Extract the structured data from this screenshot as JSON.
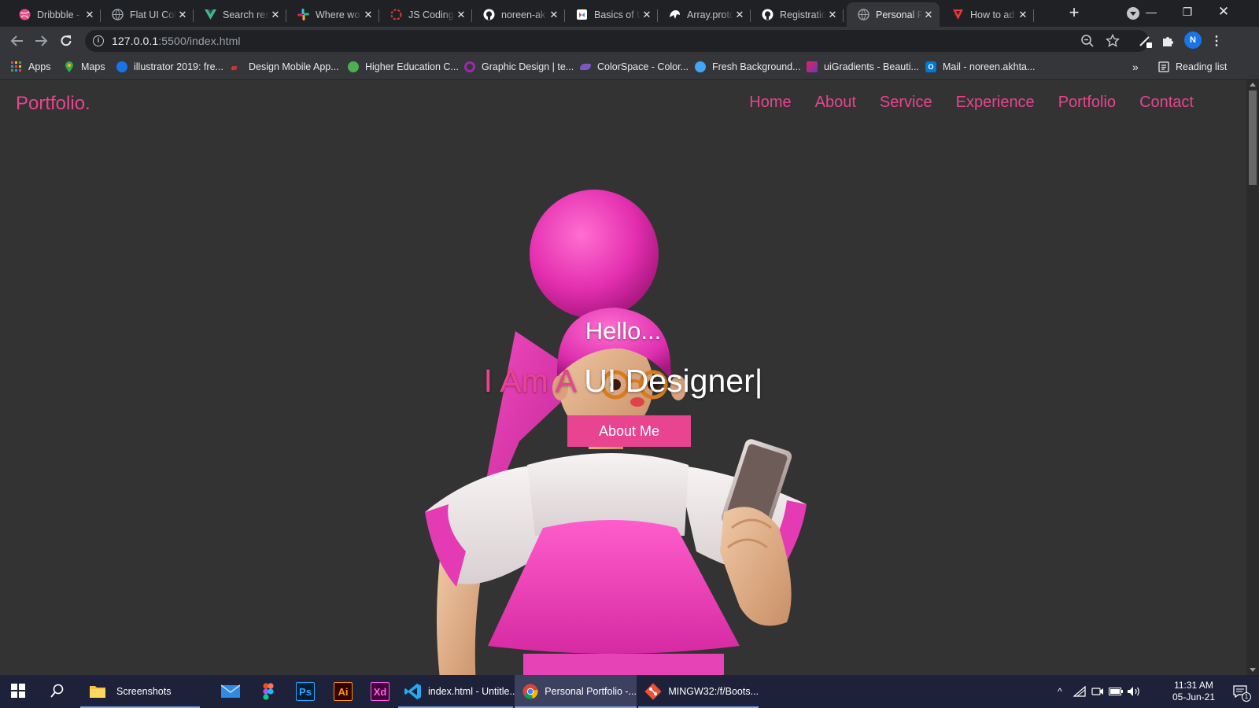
{
  "browser": {
    "tabs": [
      {
        "title": "Dribbble -",
        "icon": "dribbble-icon",
        "icon_color": "#ea4c89",
        "active": false
      },
      {
        "title": "Flat UI Col",
        "icon": "globe-icon",
        "icon_color": "#9aa0a6",
        "active": false
      },
      {
        "title": "Search res",
        "icon": "vue-icon",
        "icon_color": "#41b883",
        "active": false
      },
      {
        "title": "Where wo",
        "icon": "slack-icon",
        "icon_color": "#e01e5a",
        "active": false
      },
      {
        "title": "JS Coding",
        "icon": "loading-icon",
        "icon_color": "#e53935",
        "active": false
      },
      {
        "title": "noreen-ak",
        "icon": "github-icon",
        "icon_color": "#ffffff",
        "active": false
      },
      {
        "title": "Basics of U",
        "icon": "google-docs-icon",
        "icon_color": "#ffffff",
        "active": false
      },
      {
        "title": "Array.protc",
        "icon": "mdn-icon",
        "icon_color": "#ffffff",
        "active": false
      },
      {
        "title": "Registratio",
        "icon": "github-icon",
        "icon_color": "#ffffff",
        "active": false
      },
      {
        "title": "Personal P",
        "icon": "globe-icon",
        "icon_color": "#9aa0a6",
        "active": true
      },
      {
        "title": "How to ad",
        "icon": "vivaldi-icon",
        "icon_color": "#e53935",
        "active": false
      }
    ],
    "url": {
      "host": "127.0.0.1",
      "rest": ":5500/index.html"
    },
    "bookmarks": [
      {
        "label": "Apps",
        "icon": "apps-grid-icon",
        "color": "#f4b400"
      },
      {
        "label": "Maps",
        "icon": "maps-pin-icon",
        "color": "#34a853"
      },
      {
        "label": "illustrator 2019: fre...",
        "icon": "site-icon",
        "color": "#1a73e8"
      },
      {
        "label": "Design Mobile App...",
        "icon": "site-icon",
        "color": "#e53935"
      },
      {
        "label": "Higher Education C...",
        "icon": "site-icon",
        "color": "#4caf50"
      },
      {
        "label": "Graphic Design | te...",
        "icon": "site-icon",
        "color": "#9c27b0"
      },
      {
        "label": "ColorSpace - Color...",
        "icon": "site-icon",
        "color": "#7e57c2"
      },
      {
        "label": "Fresh Background...",
        "icon": "site-icon",
        "color": "#42a5f5"
      },
      {
        "label": "uiGradients - Beauti...",
        "icon": "site-icon",
        "color": "#e91e63"
      },
      {
        "label": "Mail - noreen.akhta...",
        "icon": "outlook-icon",
        "color": "#0078d4"
      }
    ],
    "reading_list": "Reading list"
  },
  "page": {
    "logo": "Portfolio.",
    "nav": [
      "Home",
      "About",
      "Service",
      "Experience",
      "Portfolio",
      "Contact"
    ],
    "hero": {
      "greeting": "Hello...",
      "prefix": "I Am A",
      "role": "UI Designer|",
      "button": "About Me"
    },
    "accent_color": "#e8448f",
    "background_color": "#333333"
  },
  "taskbar": {
    "apps": [
      {
        "label": "Screenshots",
        "icon": "folder-icon"
      },
      {
        "label": "",
        "icon": "mail-icon"
      },
      {
        "label": "",
        "icon": "figma-icon"
      },
      {
        "label": "Ps",
        "icon": "photoshop-icon"
      },
      {
        "label": "Ai",
        "icon": "illustrator-icon"
      },
      {
        "label": "Xd",
        "icon": "xd-icon"
      },
      {
        "label": "index.html - Untitle...",
        "icon": "vscode-icon"
      },
      {
        "label": "Personal Portfolio -...",
        "icon": "chrome-icon"
      },
      {
        "label": "MINGW32:/f/Boots...",
        "icon": "git-icon"
      }
    ],
    "clock": {
      "time": "11:31 AM",
      "date": "05-Jun-21"
    },
    "notification_count": "1"
  }
}
